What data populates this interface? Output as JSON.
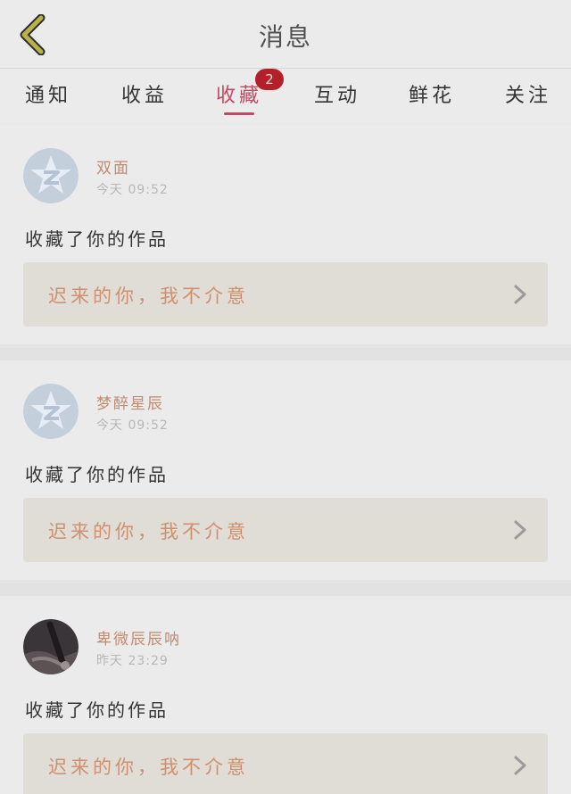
{
  "header": {
    "title": "消息",
    "back_icon": "back-chevron-icon"
  },
  "tabs": [
    {
      "label": "通知",
      "active": false
    },
    {
      "label": "收益",
      "active": false
    },
    {
      "label": "收藏",
      "active": true,
      "badge": "2"
    },
    {
      "label": "互动",
      "active": false
    },
    {
      "label": "鲜花",
      "active": false
    },
    {
      "label": "关注",
      "active": false
    }
  ],
  "items": [
    {
      "user": "双面",
      "time": "今天 09:52",
      "action": "收藏了你的作品",
      "work_title": "迟来的你，我不介意",
      "avatar_icon": "default-avatar-icon"
    },
    {
      "user": "梦醉星辰",
      "time": "今天 09:52",
      "action": "收藏了你的作品",
      "work_title": "迟来的你，我不介意",
      "avatar_icon": "default-avatar-icon"
    },
    {
      "user": "卑微辰辰呐",
      "time": "昨天 23:29",
      "action": "收藏了你的作品",
      "work_title": "迟来的你，我不介意",
      "avatar_icon": "photo-avatar-icon"
    }
  ],
  "colors": {
    "accent": "#c04a63",
    "badge": "#b3202a",
    "username": "#c28b70",
    "work_title": "#d0906f",
    "back_icon_fill": "#b8b24a"
  }
}
